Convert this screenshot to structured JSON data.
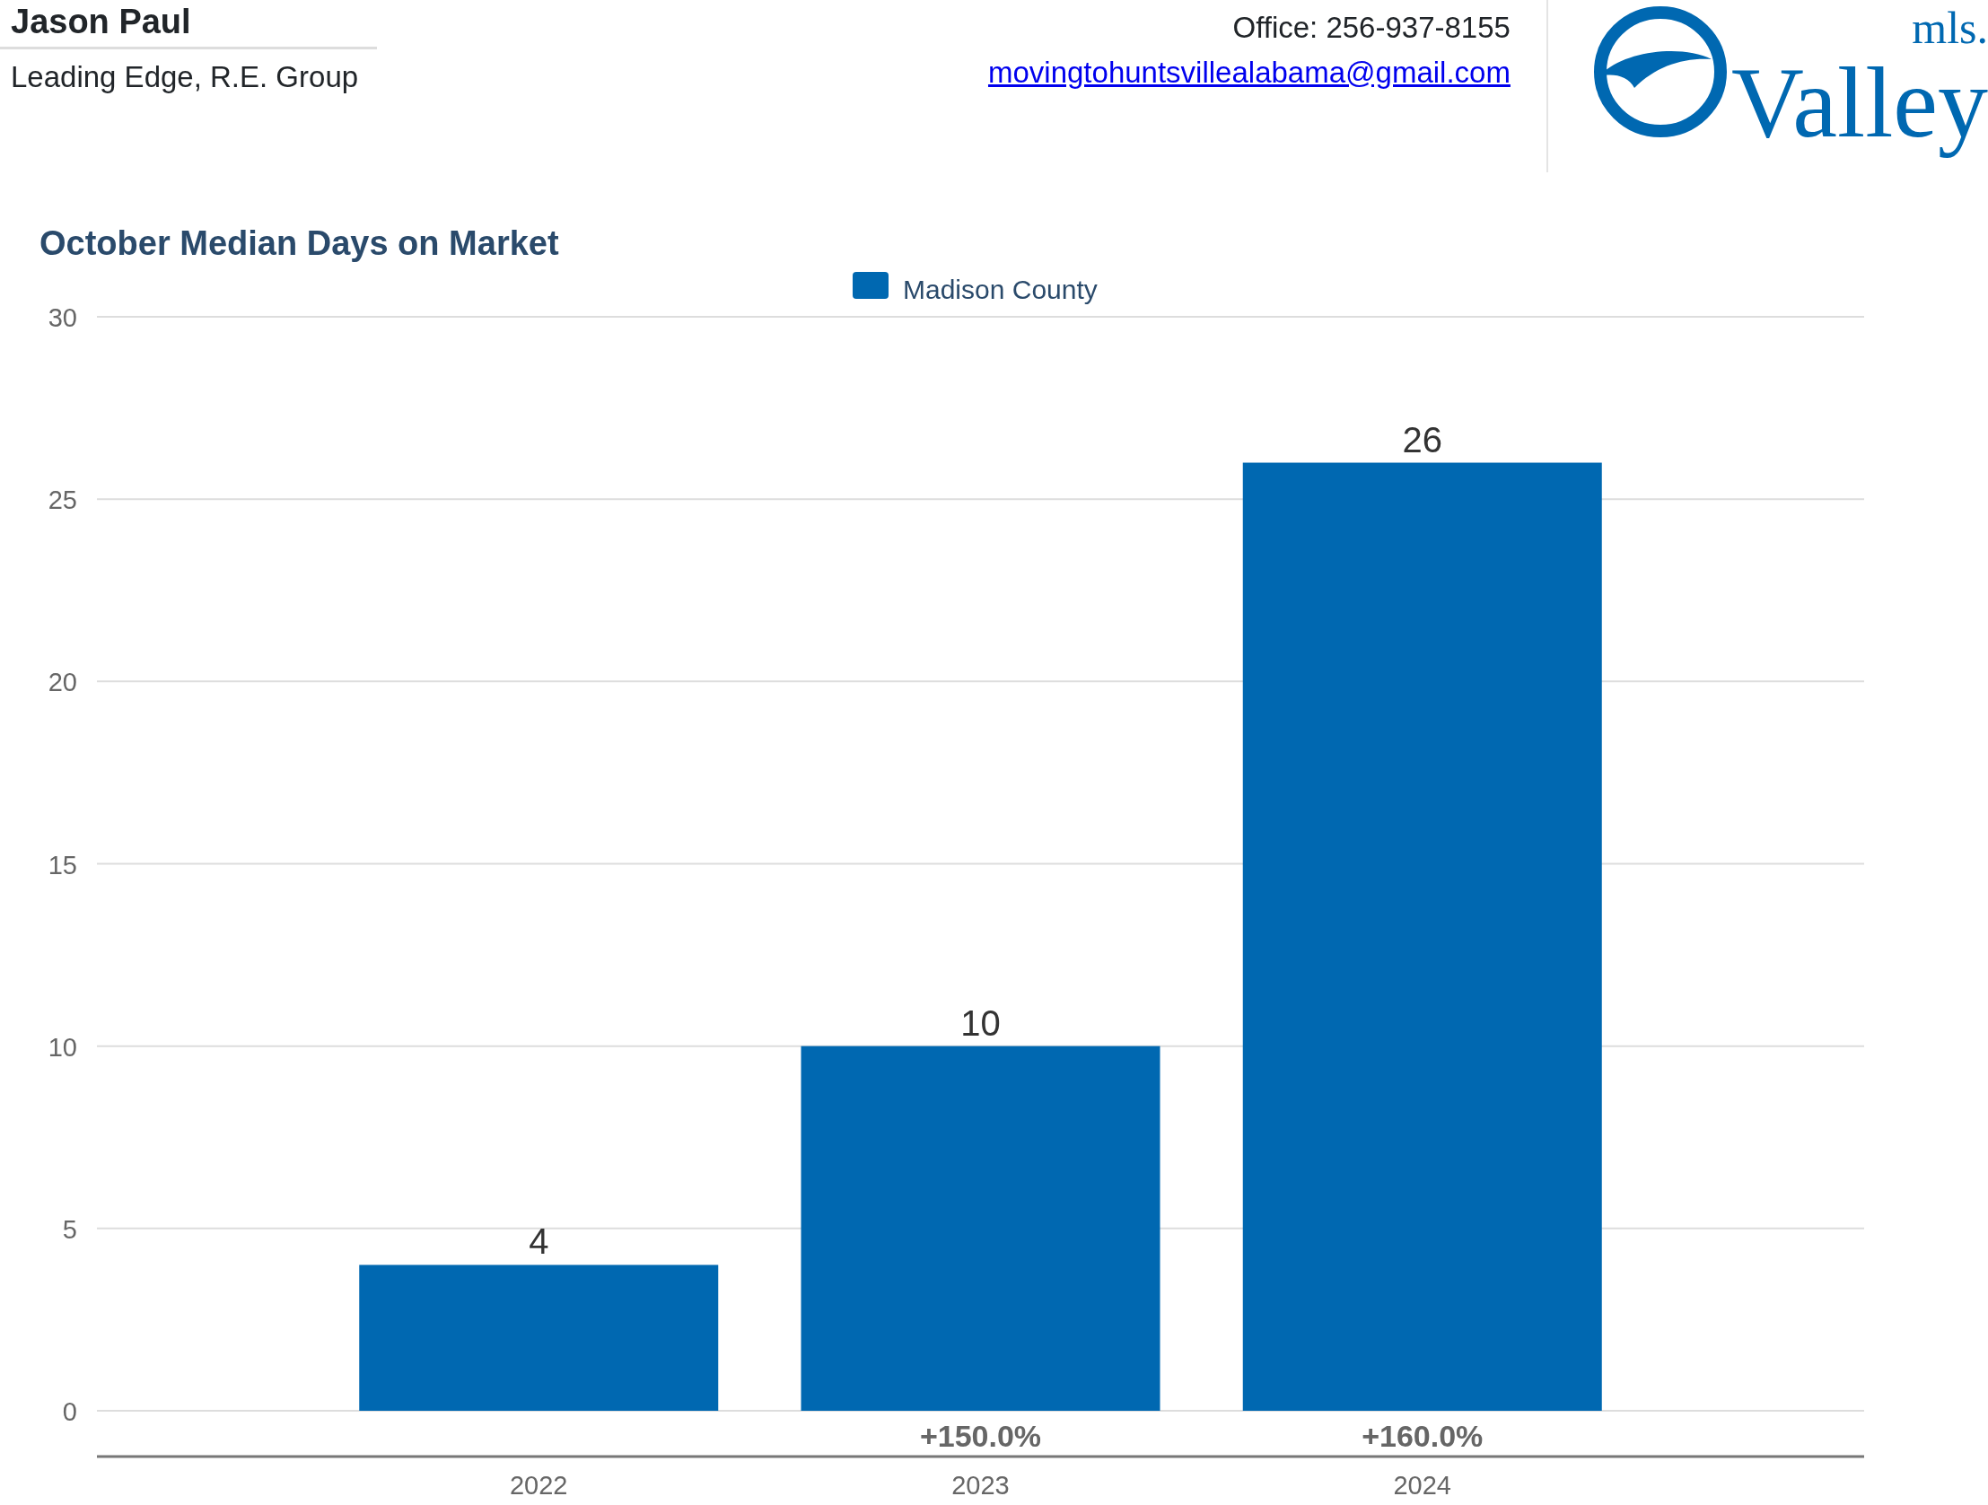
{
  "agent": {
    "name": "Jason Paul",
    "company": "Leading Edge, R.E. Group",
    "office": "Office: 256-937-8155",
    "email": "movingtohuntsvillealabama@gmail.com"
  },
  "logo": {
    "prefix": "mls.",
    "word": "Valley"
  },
  "chart": {
    "chart_data": {
      "type": "bar",
      "title": "October Median Days on Market",
      "categories": [
        "2022",
        "2023",
        "2024"
      ],
      "series": [
        {
          "name": "Madison County",
          "color": "#0068b1",
          "values": [
            4,
            10,
            26
          ]
        }
      ],
      "ylim": [
        0,
        30
      ],
      "grid": true,
      "yticks": [
        0,
        5,
        10,
        15,
        20,
        25,
        30
      ],
      "data_labels": true,
      "annotations": [
        "+150.0%",
        "+160.0%"
      ]
    }
  }
}
